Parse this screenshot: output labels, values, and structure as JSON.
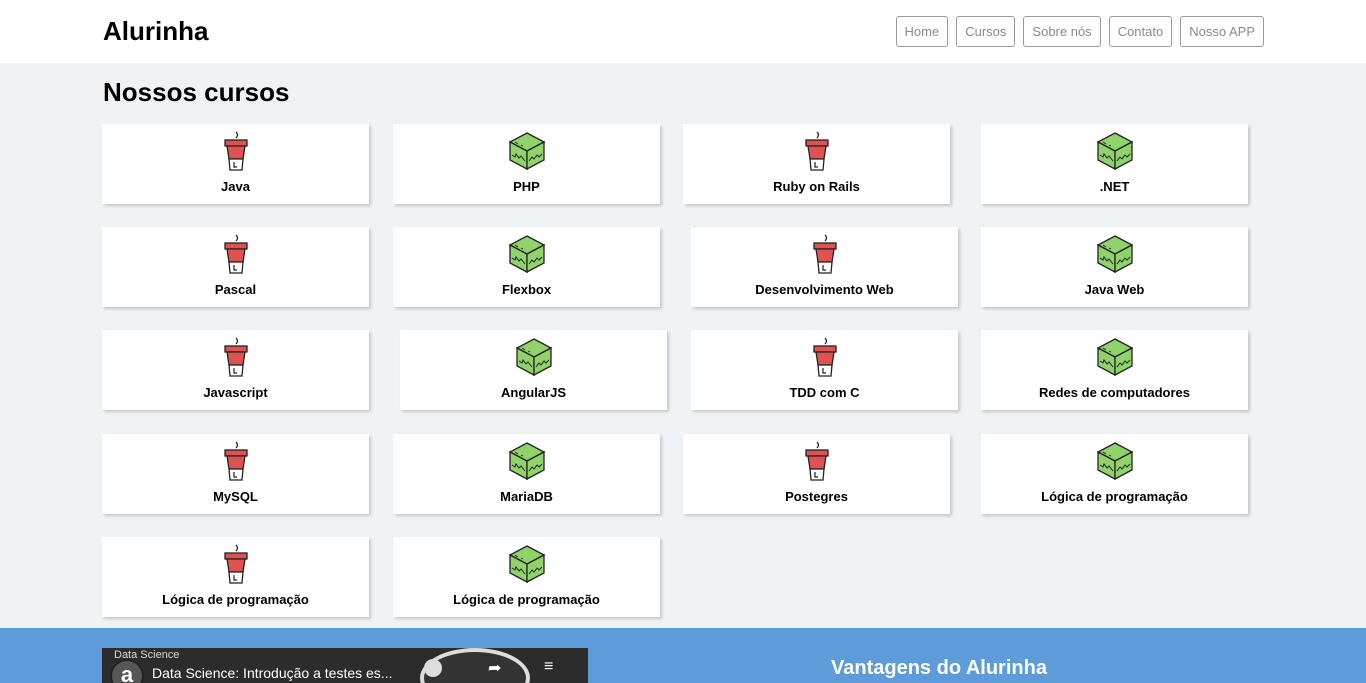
{
  "header": {
    "brand": "Alurinha",
    "nav": [
      "Home",
      "Cursos",
      "Sobre nós",
      "Contato",
      "Nosso APP"
    ]
  },
  "main": {
    "title": "Nossos cursos",
    "courses": [
      {
        "label": "Java",
        "icon": "coffee-cup-icon"
      },
      {
        "label": "PHP",
        "icon": "cube-icon"
      },
      {
        "label": "Ruby on Rails",
        "icon": "coffee-cup-icon"
      },
      {
        "label": ".NET",
        "icon": "cube-icon"
      },
      {
        "label": "Pascal",
        "icon": "coffee-cup-icon"
      },
      {
        "label": "Flexbox",
        "icon": "cube-icon"
      },
      {
        "label": "Desenvolvimento Web",
        "icon": "coffee-cup-icon"
      },
      {
        "label": "Java Web",
        "icon": "cube-icon"
      },
      {
        "label": "Javascript",
        "icon": "coffee-cup-icon"
      },
      {
        "label": "AngularJS",
        "icon": "cube-icon"
      },
      {
        "label": "TDD com C",
        "icon": "coffee-cup-icon"
      },
      {
        "label": "Redes de computadores",
        "icon": "cube-icon"
      },
      {
        "label": "MySQL",
        "icon": "coffee-cup-icon"
      },
      {
        "label": "MariaDB",
        "icon": "cube-icon"
      },
      {
        "label": "Postegres",
        "icon": "coffee-cup-icon"
      },
      {
        "label": "Lógica de programação",
        "icon": "cube-icon"
      },
      {
        "label": "Lógica de programação",
        "icon": "coffee-cup-icon"
      },
      {
        "label": "Lógica de programação",
        "icon": "cube-icon"
      }
    ]
  },
  "footer_band": {
    "video_category": "Data Science",
    "video_logo": "a",
    "video_title": "Data Science: Introdução a testes es...",
    "heading": "Vantagens do Alurinha"
  },
  "colors": {
    "page_bg": "#f0f3f6",
    "band_bg": "#5d9bd9",
    "cup_red": "#e05252",
    "cube_green": "#8fd36a"
  }
}
